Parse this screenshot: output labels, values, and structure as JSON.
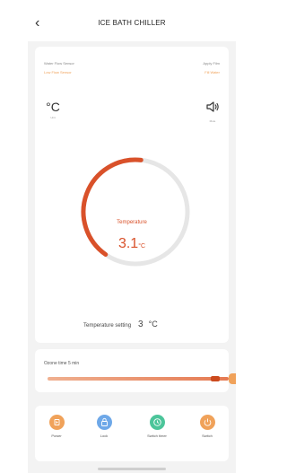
{
  "header": {
    "title": "ICE BATH CHILLER",
    "back_icon": "chevron-left"
  },
  "status": {
    "water_flow_label": "Water Flow Sensor",
    "water_flow_value": "Low Flow Sensor",
    "apply_label": "Apply Film",
    "apply_value": "Fill Water"
  },
  "unit": {
    "symbol": "°C",
    "caption": "Unit"
  },
  "sound": {
    "caption": "Mute"
  },
  "gauge": {
    "label": "Temperature",
    "value": "3.1",
    "unit": "°C",
    "fill_fraction": 0.42
  },
  "setting": {
    "label": "Temperature setting",
    "value": "3",
    "unit": "°C",
    "slider_fraction": 0.2
  },
  "ozone": {
    "label": "Ozone  time  5 min",
    "slider_fraction": 0.95
  },
  "actions": [
    {
      "label": "Power",
      "icon": "power-icon",
      "color": "#f0a25a"
    },
    {
      "label": "Lock",
      "icon": "lock-icon",
      "color": "#6ea8e8"
    },
    {
      "label": "Switch timer",
      "icon": "timer-icon",
      "color": "#4cc59a"
    },
    {
      "label": "Switch",
      "icon": "switch-icon",
      "color": "#f0a25a"
    }
  ],
  "colors": {
    "accent": "#d9512a",
    "orange": "#f0a25a",
    "background": "#f3f3f3"
  }
}
